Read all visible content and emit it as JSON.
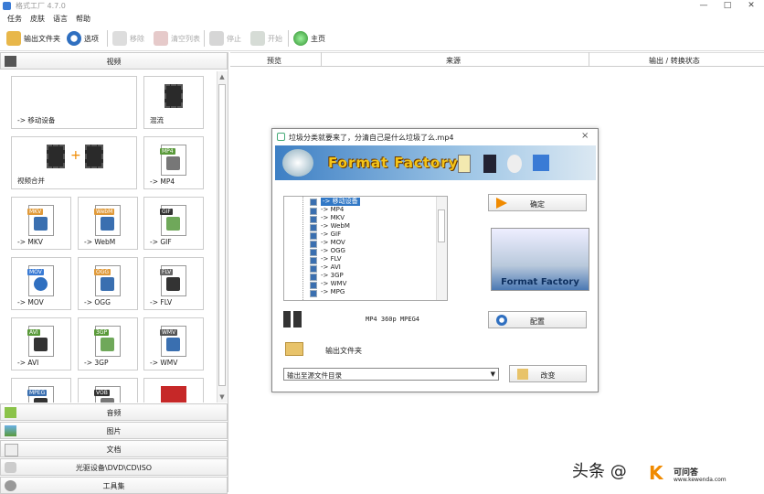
{
  "app": {
    "title": "格式工厂 4.7.0",
    "window_controls": [
      "—",
      "□",
      "✕"
    ]
  },
  "menu": [
    "任务",
    "皮肤",
    "语言",
    "帮助"
  ],
  "toolbar": {
    "output_folder": "输出文件夹",
    "options": "选项",
    "remove": "移除",
    "clear_list": "清空列表",
    "stop": "停止",
    "start": "开始",
    "home": "主页"
  },
  "left": {
    "video_cat": "视频",
    "tiles": [
      {
        "label": "-> 移动设备"
      },
      {
        "label": "混流"
      },
      {
        "label": "视频合并"
      },
      {
        "label": "-> MP4",
        "tag": "MP4"
      },
      {
        "label": "-> MKV",
        "tag": "MKV"
      },
      {
        "label": "-> WebM",
        "tag": "WebM"
      },
      {
        "label": "-> GIF",
        "tag": "GIF"
      },
      {
        "label": "-> MOV",
        "tag": "MOV"
      },
      {
        "label": "-> OGG",
        "tag": "OGG"
      },
      {
        "label": "-> FLV",
        "tag": "FLV"
      },
      {
        "label": "-> AVI",
        "tag": "AVI"
      },
      {
        "label": "-> 3GP",
        "tag": "3GP"
      },
      {
        "label": "-> WMV",
        "tag": "WMV"
      },
      {
        "label": "",
        "tag": "MPEG"
      },
      {
        "label": "",
        "tag": "VOB"
      },
      {
        "label": "",
        "tag": ""
      }
    ],
    "categories": [
      "音频",
      "图片",
      "文档",
      "光驱设备\\DVD\\CD\\ISO",
      "工具集"
    ]
  },
  "columns": [
    "预览",
    "来源",
    "输出 / 转换状态"
  ],
  "dialog": {
    "title": "垃圾分类就要来了，分清自己是什么垃圾了么.mp4",
    "close": "×",
    "banner": "Format Factory",
    "formats": [
      "-> 移动设备",
      "-> MP4",
      "-> MKV",
      "-> WebM",
      "-> GIF",
      "-> MOV",
      "-> OGG",
      "-> FLV",
      "-> AVI",
      "-> 3GP",
      "-> WMV",
      "-> MPG"
    ],
    "ok": "确定",
    "preview_text": "Format Factory",
    "format_info": "MP4 360p MPEG4",
    "config": "配置",
    "output_folder_label": "输出文件夹",
    "output_select": "输出至源文件目录",
    "change": "改变"
  },
  "watermark": {
    "left": "头条 @",
    "k": "K",
    "site_name": "可问答",
    "site_url": "www.kewenda.com"
  }
}
